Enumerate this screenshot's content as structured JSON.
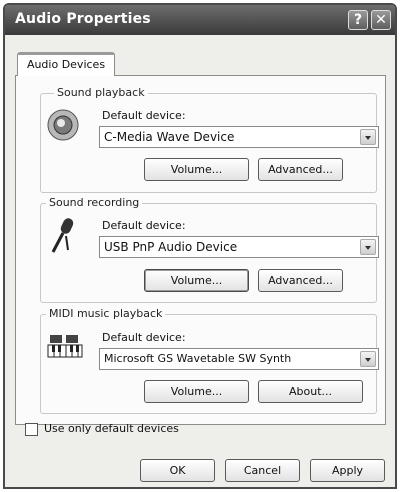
{
  "window": {
    "title": "Audio Properties",
    "help_glyph": "?",
    "close_glyph": "✕"
  },
  "tab": {
    "label": "Audio Devices"
  },
  "sound_playback": {
    "label": "Sound playback",
    "device_label": "Default device:",
    "device_value": "C-Media Wave Device",
    "volume_button": "Volume...",
    "secondary_button": "Advanced...",
    "icon": "speaker-icon"
  },
  "sound_recording": {
    "label": "Sound recording",
    "device_label": "Default device:",
    "device_value": "USB PnP Audio Device",
    "volume_button": "Volume...",
    "secondary_button": "Advanced...",
    "icon": "microphone-icon"
  },
  "midi_playback": {
    "label": "MIDI music playback",
    "device_label": "Default device:",
    "device_value": "Microsoft GS Wavetable SW Synth",
    "volume_button": "Volume...",
    "secondary_button": "About...",
    "icon": "midi-keyboard-icon"
  },
  "options": {
    "use_only_default": "Use only default devices",
    "use_only_default_checked": false
  },
  "footer": {
    "ok": "OK",
    "cancel": "Cancel",
    "apply": "Apply"
  }
}
